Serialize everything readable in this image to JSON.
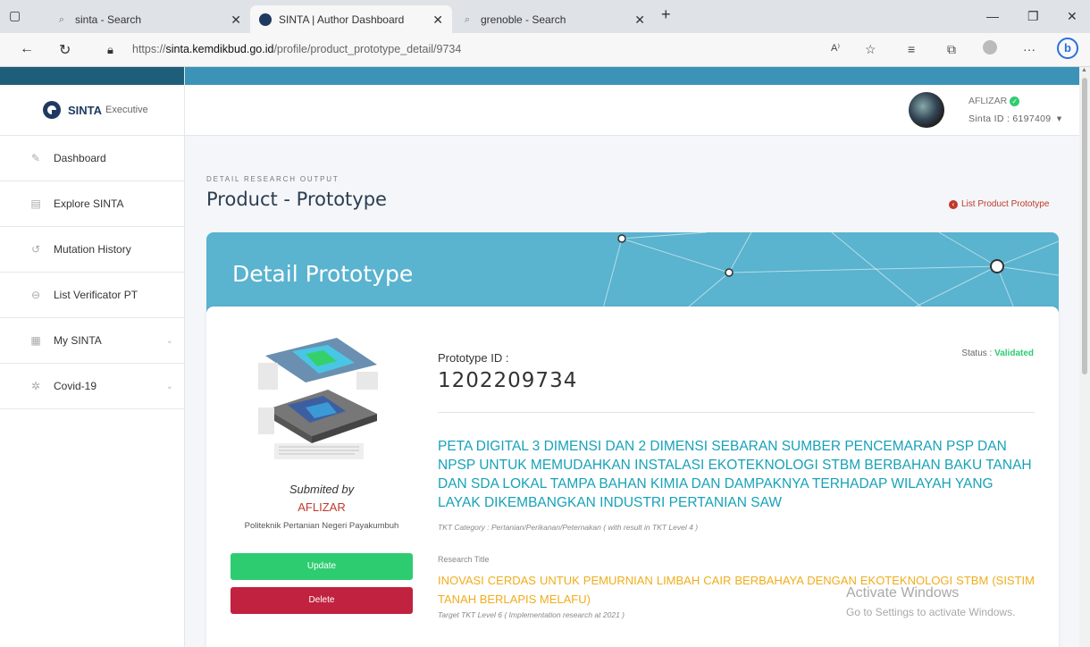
{
  "browser": {
    "tabs": [
      {
        "title": "sinta - Search"
      },
      {
        "title": "SINTA | Author Dashboard"
      },
      {
        "title": "grenoble - Search"
      }
    ],
    "url_prefix": "https://",
    "url_domain": "sinta.kemdikbud.go.id",
    "url_path": "/profile/product_prototype_detail/9734"
  },
  "sidebar": {
    "brand": "SINTA",
    "brand_sub": "Executive",
    "items": [
      {
        "label": "Dashboard"
      },
      {
        "label": "Explore SINTA"
      },
      {
        "label": "Mutation History"
      },
      {
        "label": "List Verificator PT"
      },
      {
        "label": "My SINTA"
      },
      {
        "label": "Covid-19"
      }
    ]
  },
  "header": {
    "user_name": "AFLIZAR",
    "sinta_id": "Sinta ID : 6197409"
  },
  "main": {
    "section_label": "DETAIL RESEARCH OUTPUT",
    "page_title": "Product - Prototype",
    "list_link": "List Product Prototype",
    "banner_title": "Detail Prototype",
    "submitted_by": "Submited by",
    "author": "AFLIZAR",
    "institution": "Politeknik Pertanian Negeri Payakumbuh",
    "update_label": "Update",
    "delete_label": "Delete",
    "prototype_id_label": "Prototype ID :",
    "prototype_id": "1202209734",
    "status_label": "Status :",
    "status_value": "Validated",
    "prototype_title": "PETA DIGITAL 3 DIMENSI DAN 2 DIMENSI SEBARAN SUMBER PENCEMARAN PSP DAN NPSP UNTUK MEMUDAHKAN INSTALASI EKOTEKNOLOGI STBM BERBAHAN BAKU TANAH DAN SDA LOKAL TAMPA BAHAN KIMIA DAN DAMPAKNYA TERHADAP WILAYAH YANG LAYAK DIKEMBANGKAN INDUSTRI PERTANIAN SAW",
    "tkt_category": "TKT Category : Pertanian/Perikanan/Peternakan ( with result in TKT Level 4 )",
    "research_title_label": "Research Title",
    "research_title": "INOVASI CERDAS UNTUK PEMURNIAN LIMBAH CAIR BERBAHAYA DENGAN EKOTEKNOLOGI STBM (SISTIM TANAH BERLAPIS MELAFU)",
    "target_tkt": "Target TKT Level 6 ( Implementation research at 2021 )"
  },
  "watermark": {
    "line1": "Activate Windows",
    "line2": "Go to Settings to activate Windows."
  },
  "colors": {
    "brand_dark": "#1f5e7a",
    "banner": "#5ab3cf",
    "accent_teal": "#17a2b8",
    "accent_orange": "#f0ad1c",
    "success": "#2ecc71",
    "danger": "#c0223f"
  }
}
